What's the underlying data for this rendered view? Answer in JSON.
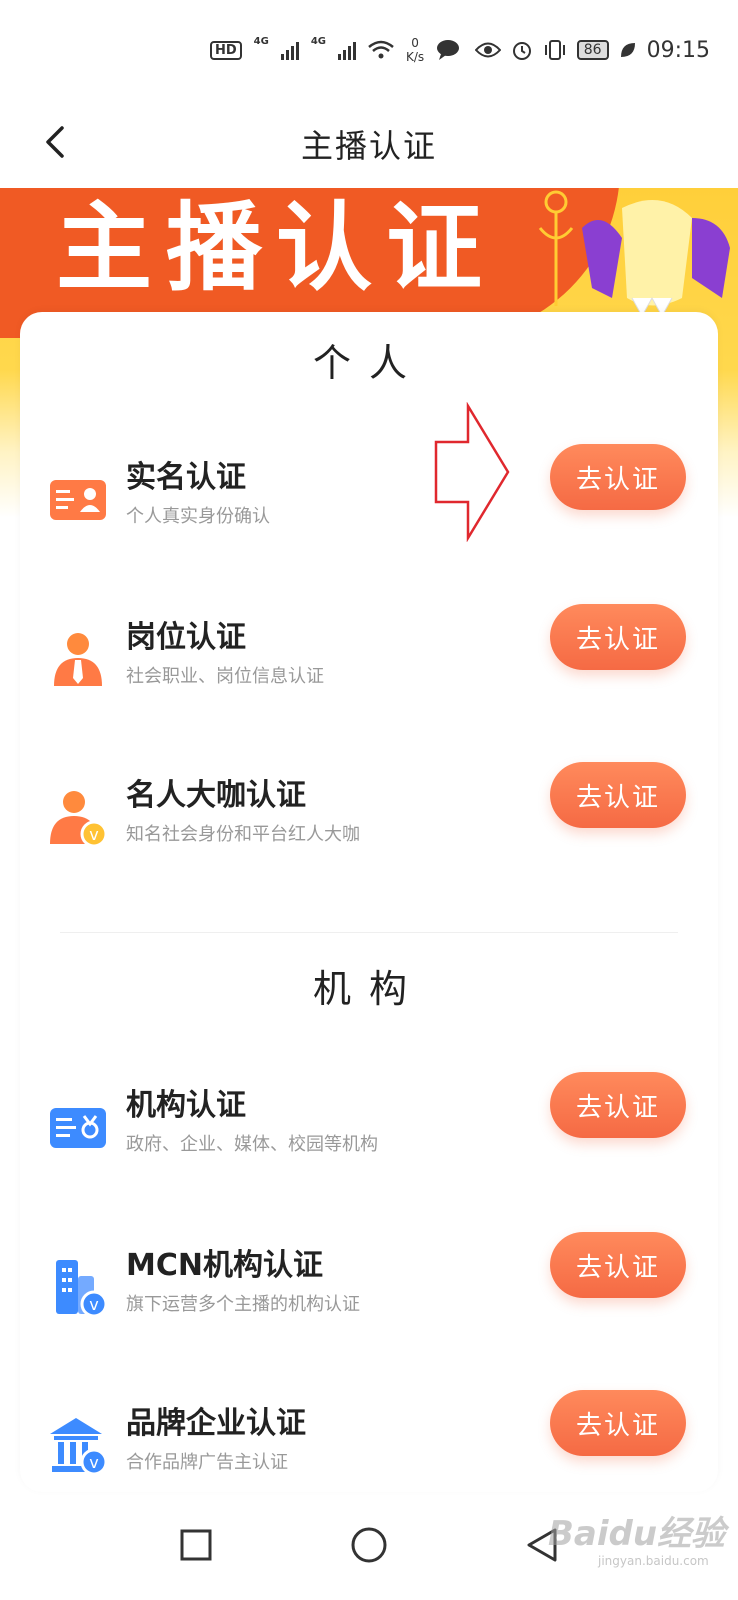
{
  "status_bar": {
    "hd": "HD",
    "net1": "4G",
    "net2": "4G",
    "speed_value": "0",
    "speed_unit": "K/s",
    "battery": "86",
    "time": "09:15"
  },
  "nav": {
    "title": "主播认证"
  },
  "banner": {
    "text": "主播认证"
  },
  "sections": {
    "personal": {
      "title": "个人",
      "items": [
        {
          "title": "实名认证",
          "desc": "个人真实身份确认",
          "button": "去认证"
        },
        {
          "title": "岗位认证",
          "desc": "社会职业、岗位信息认证",
          "button": "去认证"
        },
        {
          "title": "名人大咖认证",
          "desc": "知名社会身份和平台红人大咖",
          "button": "去认证"
        }
      ]
    },
    "org": {
      "title": "机构",
      "items": [
        {
          "title": "机构认证",
          "desc": "政府、企业、媒体、校园等机构",
          "button": "去认证"
        },
        {
          "title": "MCN机构认证",
          "desc": "旗下运营多个主播的机构认证",
          "button": "去认证"
        },
        {
          "title": "品牌企业认证",
          "desc": "合作品牌广告主认证",
          "button": "去认证"
        }
      ]
    }
  },
  "watermark": {
    "main": "Baidu经验",
    "sub": "jingyan.baidu.com"
  },
  "colors": {
    "accent": "#f56a44",
    "banner_red": "#f05a24",
    "banner_yellow": "#ffcf3a"
  }
}
